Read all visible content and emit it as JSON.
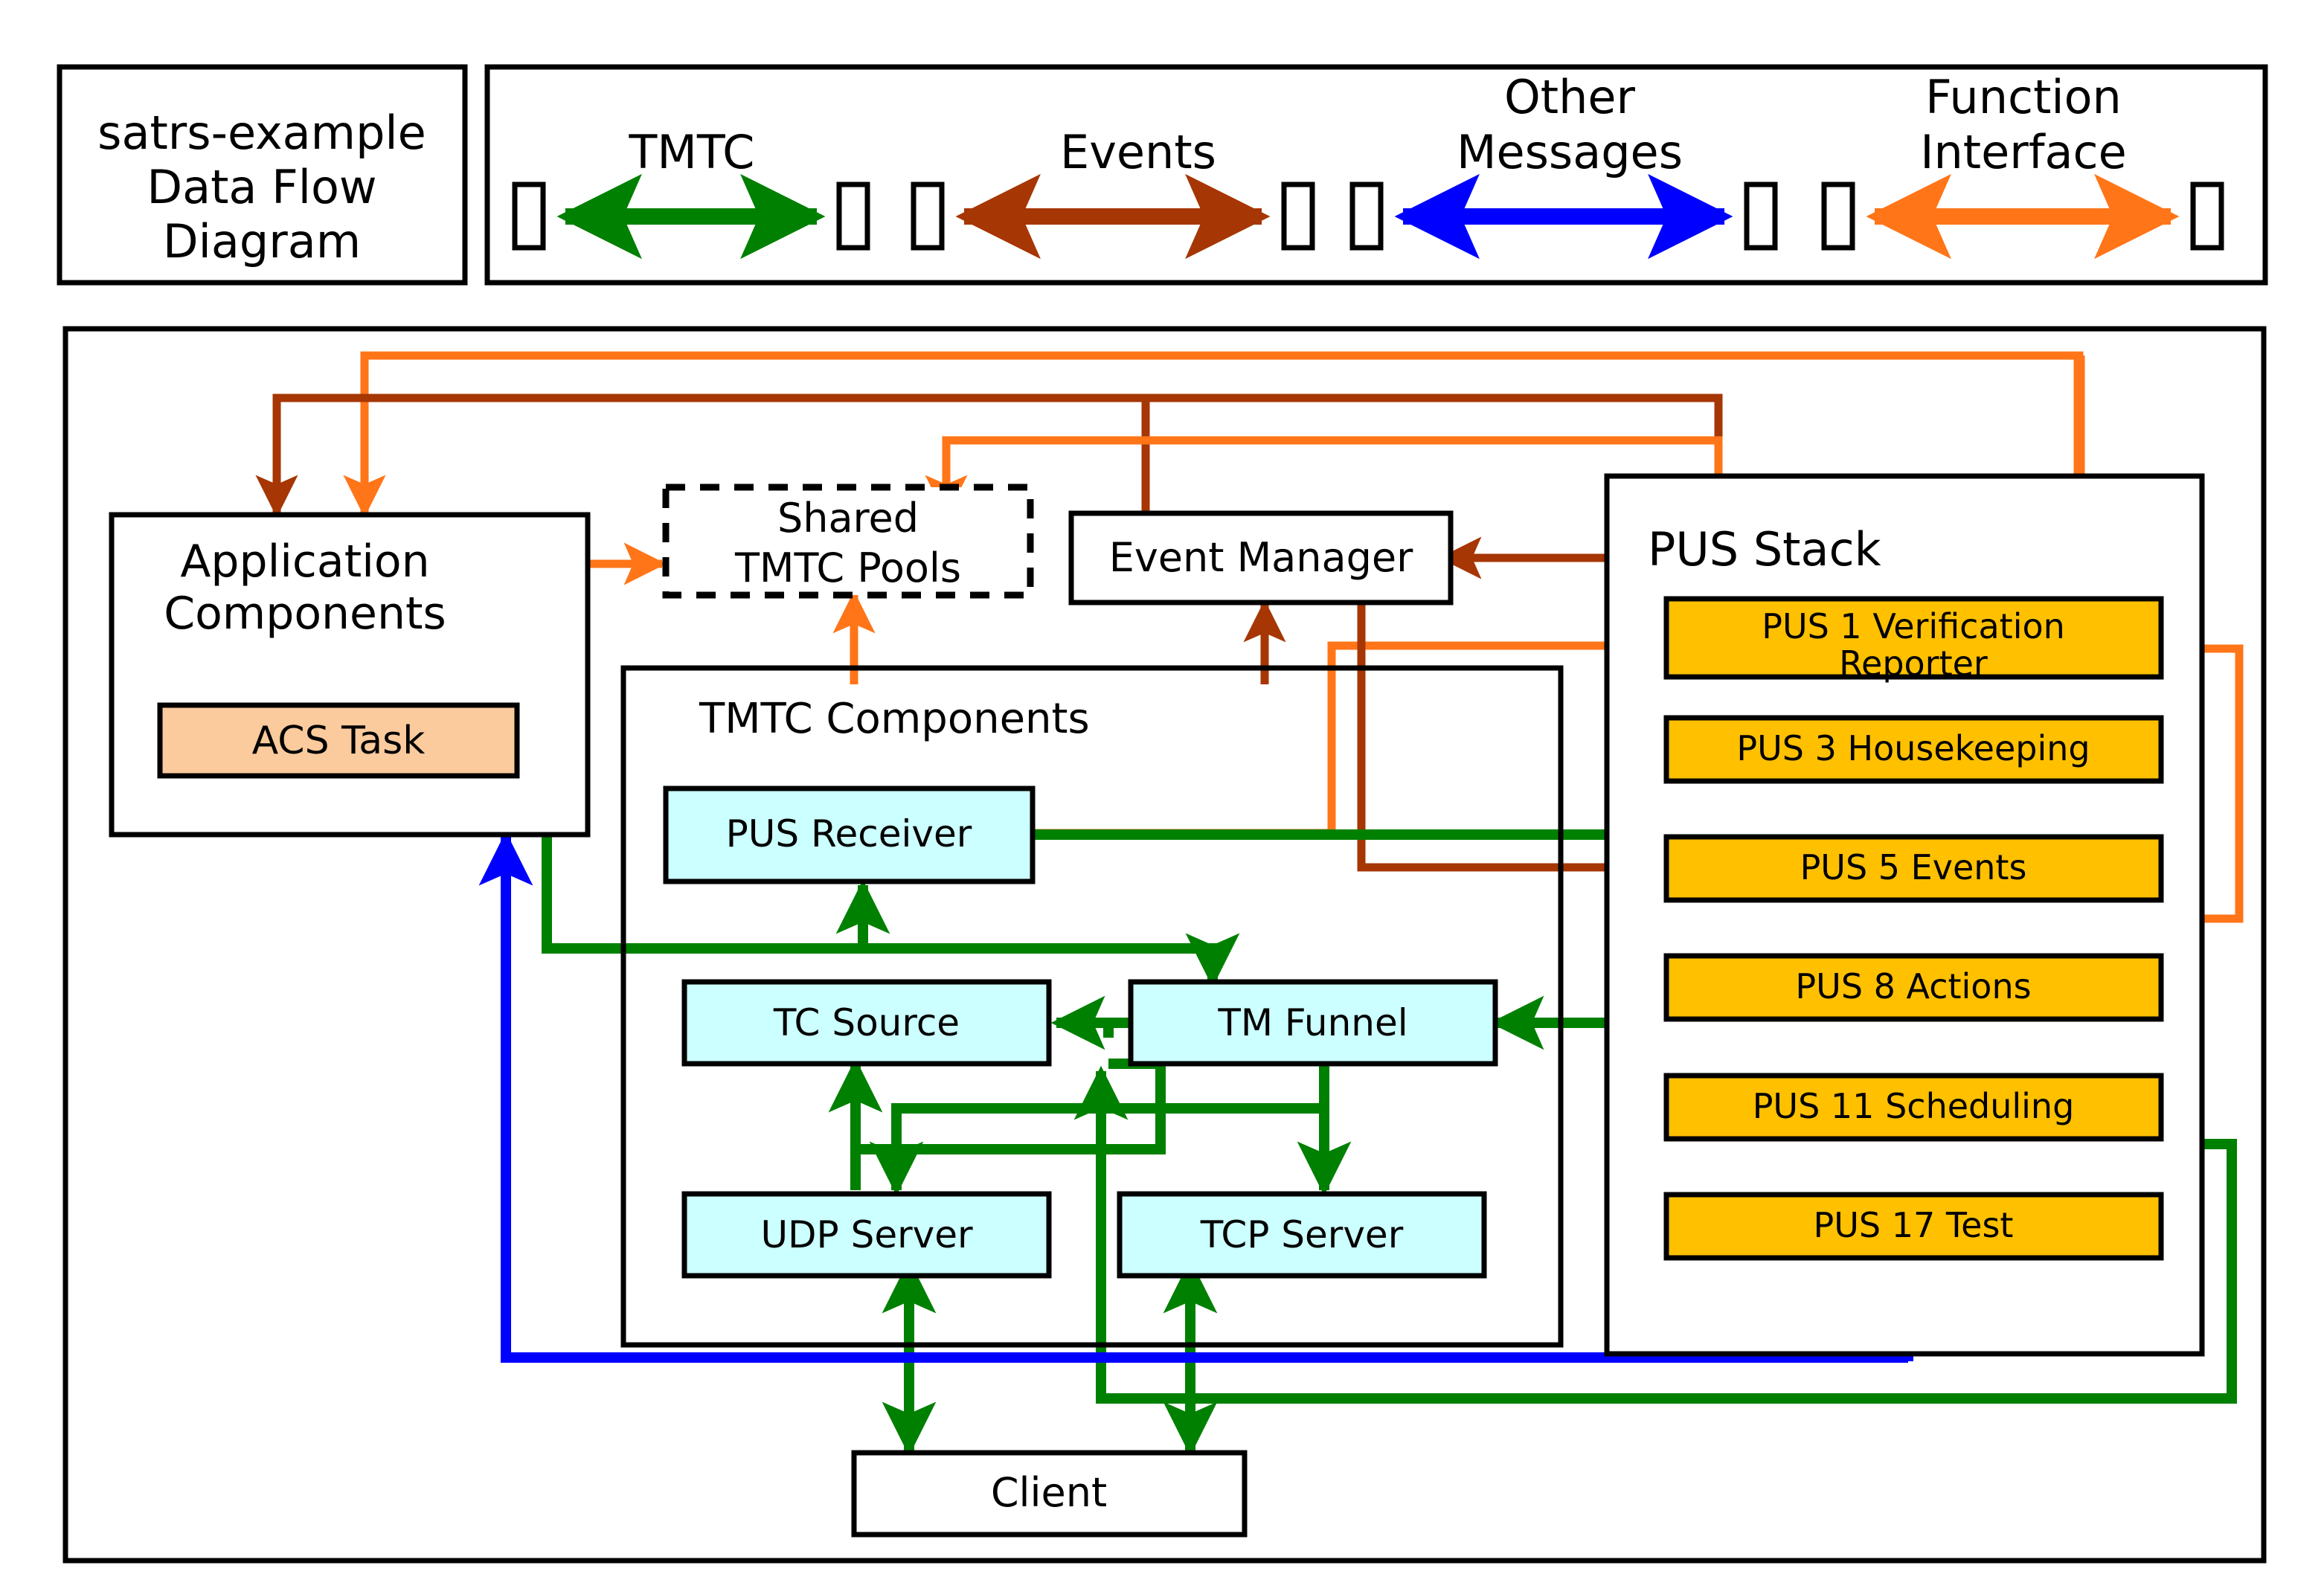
{
  "title_box": {
    "lines": [
      "satrs-example",
      "Data Flow",
      "Diagram"
    ]
  },
  "legend": {
    "items": [
      {
        "label": "TMTC",
        "color": "#008000",
        "name": "legend-tmtc"
      },
      {
        "label": "Events",
        "color": "#A63603",
        "name": "legend-events"
      },
      {
        "label_line1": "Other",
        "label_line2": "Messages",
        "color": "#0000FF",
        "name": "legend-other-messages"
      },
      {
        "label_line1": "Function",
        "label_line2": "Interface",
        "color": "#FF7518",
        "name": "legend-function-interface"
      }
    ]
  },
  "diagram": {
    "application_components": {
      "title_line1": "Application",
      "title_line2": "Components",
      "children": [
        {
          "label": "ACS Task",
          "fill": "#FBCA9D"
        }
      ]
    },
    "shared_tmtc_pools": {
      "title_line1": "Shared",
      "title_line2": "TMTC Pools",
      "dashed": true
    },
    "event_manager": {
      "label": "Event Manager"
    },
    "pus_stack": {
      "title": "PUS Stack",
      "services": [
        {
          "label_line1": "PUS 1 Verification",
          "label_line2": "Reporter",
          "fill": "#FFC000"
        },
        {
          "label": "PUS 3 Housekeeping",
          "fill": "#FFC000"
        },
        {
          "label": "PUS 5 Events",
          "fill": "#FFC000"
        },
        {
          "label": "PUS 8 Actions",
          "fill": "#FFC000"
        },
        {
          "label": "PUS 11 Scheduling",
          "fill": "#FFC000"
        },
        {
          "label": "PUS 17 Test",
          "fill": "#FFC000"
        }
      ]
    },
    "tmtc_components": {
      "title": "TMTC Components",
      "children": [
        {
          "label": "PUS Receiver",
          "fill": "#CCFFFF"
        },
        {
          "label": "TC Source",
          "fill": "#CCFFFF"
        },
        {
          "label": "TM Funnel",
          "fill": "#CCFFFF"
        },
        {
          "label": "UDP Server",
          "fill": "#CCFFFF"
        },
        {
          "label": "TCP Server",
          "fill": "#CCFFFF"
        }
      ]
    },
    "client": {
      "label": "Client"
    }
  },
  "colors": {
    "tmtc": "#008000",
    "events": "#A63603",
    "other_messages": "#0000FF",
    "function_interface": "#FF7518",
    "stroke": "#000000",
    "pus_fill": "#FFC000",
    "tmtc_fill": "#CCFFFF",
    "acs_fill": "#FBCA9D"
  }
}
